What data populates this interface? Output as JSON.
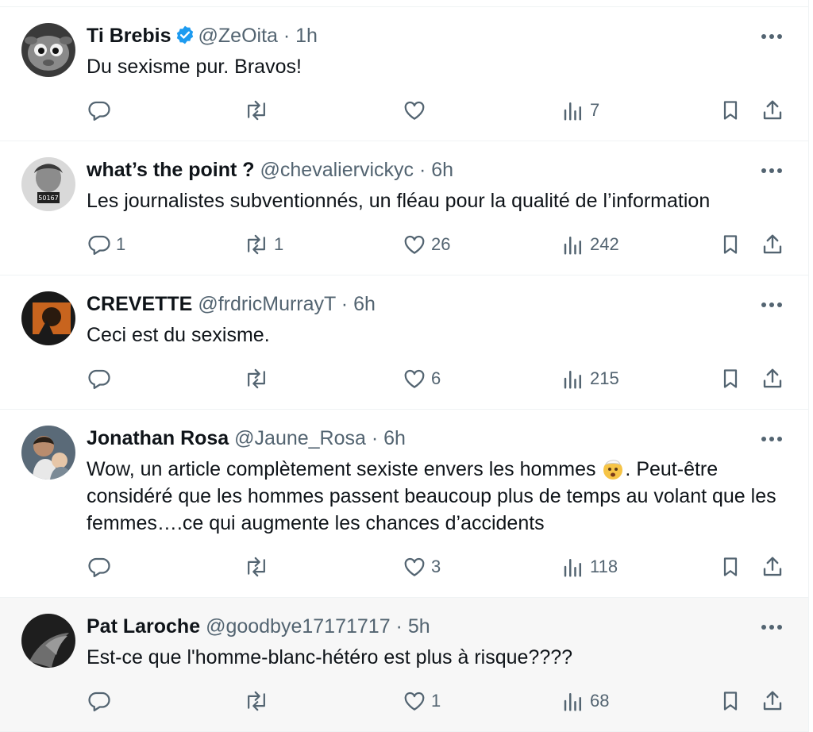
{
  "tweets": [
    {
      "name": "Ti Brebis",
      "handle": "@ZeOita",
      "time": "1h",
      "verified": true,
      "text": "Du sexisme pur. Bravos!",
      "replies": "",
      "reposts": "",
      "likes": "",
      "views": "7"
    },
    {
      "name": "what’s the point ?",
      "handle": "@chevaliervickyc",
      "time": "6h",
      "verified": false,
      "text": "Les journalistes subventionnés, un fléau pour la qualité de l’information",
      "replies": "1",
      "reposts": "1",
      "likes": "26",
      "views": "242"
    },
    {
      "name": "CREVETTE",
      "handle": "@frdricMurrayT",
      "time": "6h",
      "verified": false,
      "text": "Ceci est du sexisme.",
      "replies": "",
      "reposts": "",
      "likes": "6",
      "views": "215"
    },
    {
      "name": "Jonathan Rosa",
      "handle": "@Jaune_Rosa",
      "time": "6h",
      "verified": false,
      "text_before_emoji": "Wow, un article complètement sexiste envers les hommes ",
      "emoji": "exploding-head-emoji",
      "text_after_emoji": ". Peut-être considéré que les hommes passent beaucoup plus de temps au volant que les femmes….ce qui augmente les chances d’accidents",
      "replies": "",
      "reposts": "",
      "likes": "3",
      "views": "118"
    },
    {
      "name": "Pat Laroche",
      "handle": "@goodbye17171717",
      "time": "5h",
      "verified": false,
      "text": "Est-ce que l'homme-blanc-hétéro est plus à risque????",
      "replies": "",
      "reposts": "",
      "likes": "1",
      "views": "68"
    }
  ],
  "avatars": {
    "mugshot_sign": "50167"
  },
  "colors": {
    "text": "#0f1419",
    "secondary": "#536471",
    "verified": "#1d9bf0",
    "border": "#eff3f4",
    "highlight": "#f7f7f7"
  },
  "icons": [
    "reply-icon",
    "repost-icon",
    "like-icon",
    "views-icon",
    "bookmark-icon",
    "share-icon",
    "more-icon",
    "verified-badge-icon"
  ]
}
